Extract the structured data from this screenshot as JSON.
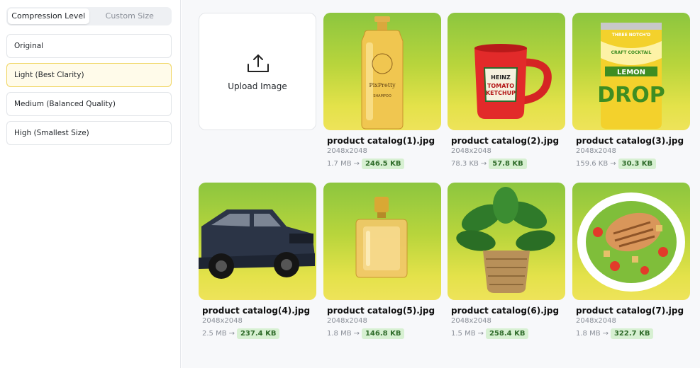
{
  "tabs": {
    "compression": "Compression Level",
    "custom": "Custom Size"
  },
  "levels": [
    {
      "label": "Original"
    },
    {
      "label": "Light (Best Clarity)"
    },
    {
      "label": "Medium (Balanced Quality)"
    },
    {
      "label": "High (Smallest Size)"
    }
  ],
  "selected_level": "Light (Best Clarity)",
  "upload": {
    "label": "Upload Image"
  },
  "arrow": "→",
  "images": [
    {
      "name": "product catalog(1).jpg",
      "dims": "2048x2048",
      "original": "1.7 MB",
      "compressed": "246.5 KB",
      "subject": "shampoo-bottle"
    },
    {
      "name": "product catalog(2).jpg",
      "dims": "2048x2048",
      "original": "78.3 KB",
      "compressed": "57.8 KB",
      "subject": "ketchup-mug"
    },
    {
      "name": "product catalog(3).jpg",
      "dims": "2048x2048",
      "original": "159.6 KB",
      "compressed": "30.3 KB",
      "subject": "lemon-drop-can"
    },
    {
      "name": "product catalog(4).jpg",
      "dims": "2048x2048",
      "original": "2.5 MB",
      "compressed": "237.4 KB",
      "subject": "suv"
    },
    {
      "name": "product catalog(5).jpg",
      "dims": "2048x2048",
      "original": "1.8 MB",
      "compressed": "146.8 KB",
      "subject": "perfume-bottle"
    },
    {
      "name": "product catalog(6).jpg",
      "dims": "2048x2048",
      "original": "1.5 MB",
      "compressed": "258.4 KB",
      "subject": "potted-plant"
    },
    {
      "name": "product catalog(7).jpg",
      "dims": "2048x2048",
      "original": "1.8 MB",
      "compressed": "322.7 KB",
      "subject": "chicken-salad"
    }
  ],
  "image_text": {
    "shampoo": [
      "PixPretty",
      "SHAMPOO"
    ],
    "ketchup": [
      "HEINZ",
      "TOMATO",
      "KETCHUP"
    ],
    "can": [
      "THREE NOTCH'D",
      "CRAFT COCKTAIL",
      "LEMON",
      "DROP"
    ]
  },
  "colors": {
    "accent_selected_border": "#f0d560",
    "badge_bg": "#d7f0d2",
    "badge_text": "#2f6b2a"
  }
}
